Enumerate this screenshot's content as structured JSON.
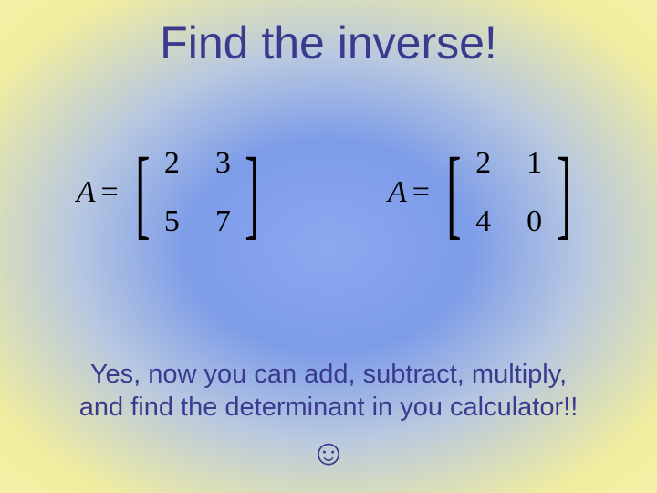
{
  "title": "Find the inverse!",
  "matrixA": {
    "lhs": "A",
    "eq": "=",
    "cells": {
      "r0c0": "2",
      "r0c1": "3",
      "r1c0": "5",
      "r1c1": "7"
    }
  },
  "matrixB": {
    "lhs": "A",
    "eq": "=",
    "cells": {
      "r0c0": "2",
      "r0c1": "1",
      "r1c0": "4",
      "r1c1": "0"
    }
  },
  "bottom": {
    "line1": "Yes, now you can add, subtract, multiply,",
    "line2": "and find the determinant in you calculator!!"
  },
  "smiley": "☺"
}
